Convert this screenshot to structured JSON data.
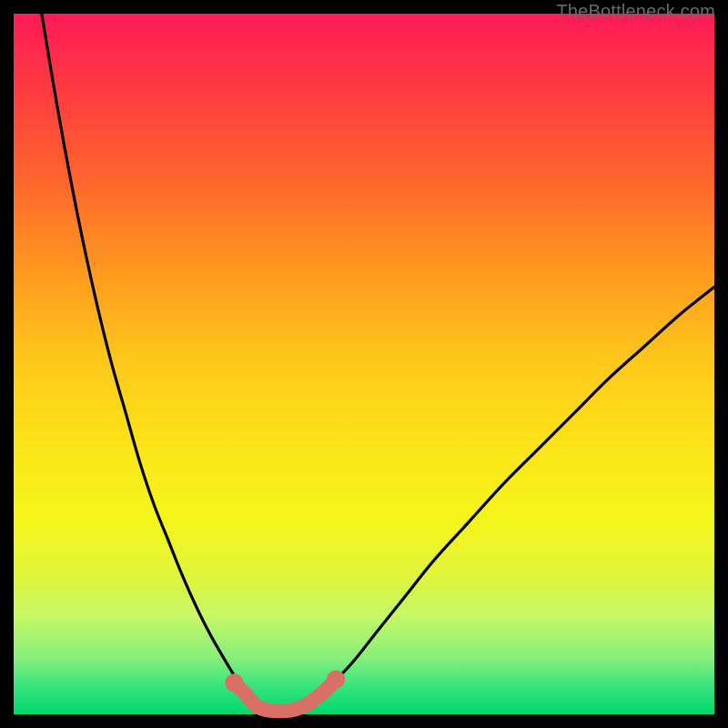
{
  "watermark": "TheBottleneck.com",
  "chart_data": {
    "type": "line",
    "title": "",
    "xlabel": "",
    "ylabel": "",
    "xlim": [
      0,
      100
    ],
    "ylim": [
      0,
      100
    ],
    "series": [
      {
        "name": "curve-left",
        "x": [
          4,
          6,
          8,
          10,
          12,
          14,
          16,
          18,
          20,
          22,
          24,
          26,
          28,
          30,
          31.5,
          33
        ],
        "y": [
          100,
          88,
          77,
          67,
          58,
          50,
          43,
          36,
          30,
          25,
          20,
          15.5,
          11.5,
          8,
          5.5,
          3
        ]
      },
      {
        "name": "flat-bottom",
        "x": [
          33,
          35,
          38,
          41,
          44
        ],
        "y": [
          3,
          1,
          0.5,
          1,
          3
        ]
      },
      {
        "name": "curve-right",
        "x": [
          44,
          48,
          52,
          56,
          60,
          65,
          70,
          75,
          80,
          85,
          90,
          95,
          100
        ],
        "y": [
          3,
          7,
          12,
          17,
          22,
          27.5,
          33,
          38,
          43,
          48,
          52.5,
          57,
          61
        ]
      }
    ],
    "highlight": {
      "name": "bottom-marker",
      "x": [
        31.5,
        33,
        35,
        38,
        41,
        44,
        46
      ],
      "y": [
        4.5,
        3,
        1,
        0.5,
        1,
        3,
        5
      ]
    }
  }
}
